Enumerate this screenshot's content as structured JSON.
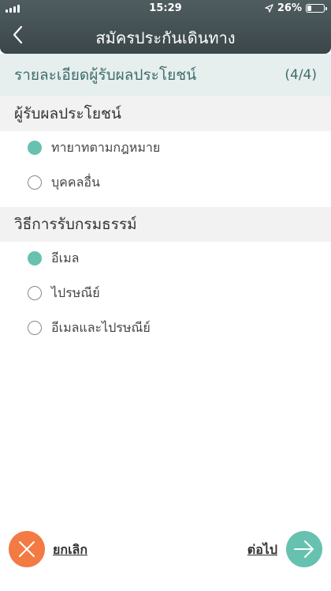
{
  "status_bar": {
    "time": "15:29",
    "battery_text": "26%",
    "battery_level": 0.26,
    "icons": [
      "signal-icon",
      "location-arrow-icon",
      "battery-icon"
    ]
  },
  "nav": {
    "title": "สมัครประกันเดินทาง",
    "back_icon": "chevron-left-icon"
  },
  "step": {
    "title": "รายละเอียดผู้รับผลประโยชน์",
    "count": "(4/4)"
  },
  "beneficiary": {
    "heading": "ผู้รับผลประโยชน์",
    "options": [
      {
        "label": "ทายาทตามกฎหมาย",
        "selected": true
      },
      {
        "label": "บุคคลอื่น",
        "selected": false
      }
    ]
  },
  "delivery": {
    "heading": "วิธีการรับกรมธรรม์",
    "options": [
      {
        "label": "อีเมล",
        "selected": true
      },
      {
        "label": "ไปรษณีย์",
        "selected": false
      },
      {
        "label": "อีเมลและไปรษณีย์",
        "selected": false
      }
    ]
  },
  "footer": {
    "cancel_label": "ยกเลิก",
    "next_label": "ต่อไป",
    "cancel_icon": "close-icon",
    "next_icon": "arrow-right-icon"
  },
  "colors": {
    "header": "#3f4b4e",
    "accent": "#66c2ae",
    "cancel": "#f37a43",
    "step_bar": "#e6efed",
    "step_text": "#3e6c6c"
  }
}
